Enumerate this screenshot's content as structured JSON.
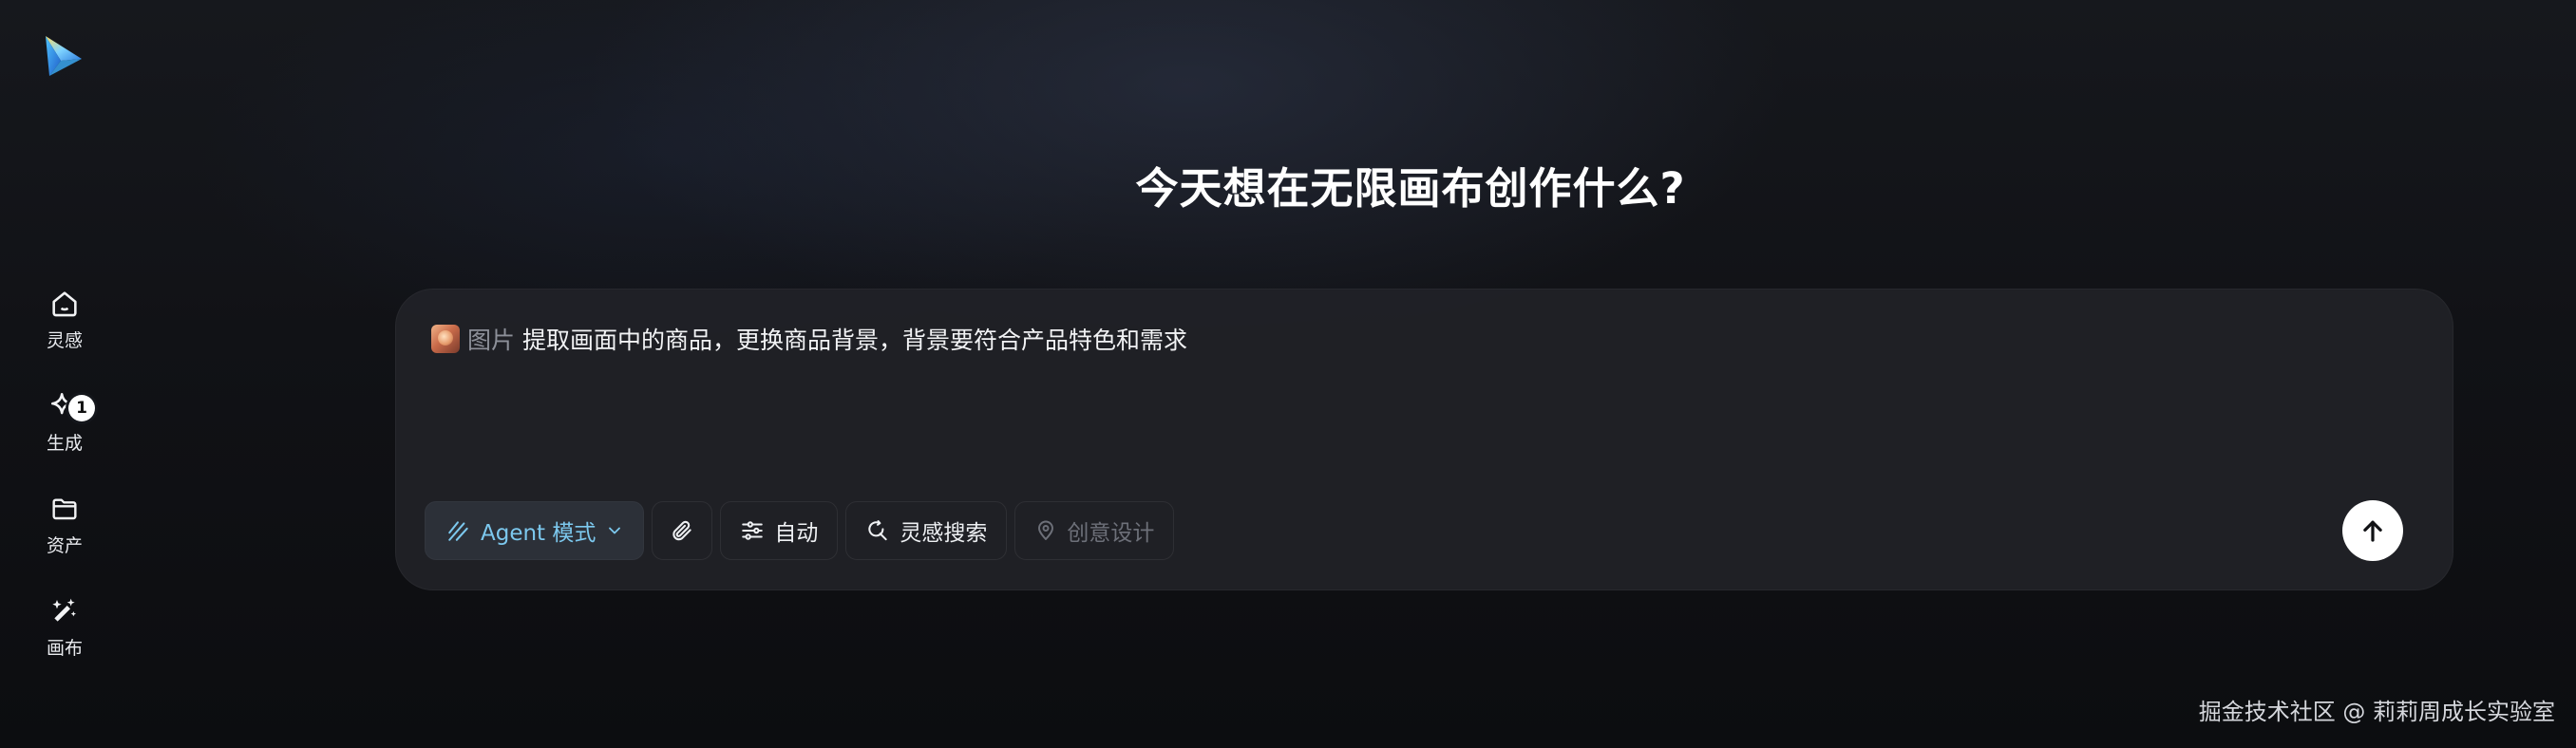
{
  "sidebar": {
    "logo": {
      "icon": "paper-plane-logo"
    },
    "items": [
      {
        "label": "灵感",
        "icon": "home-icon"
      },
      {
        "label": "生成",
        "icon": "sparkle-icon",
        "badge": "1"
      },
      {
        "label": "资产",
        "icon": "folder-icon"
      },
      {
        "label": "画布",
        "icon": "magic-wand-icon"
      }
    ]
  },
  "main": {
    "title": "今天想在无限画布创作什么?"
  },
  "composer": {
    "attachment_label": "图片",
    "prompt": "提取画面中的商品，更换商品背景，背景要符合产品特色和需求",
    "toolbar": {
      "agent_mode": "Agent 模式",
      "auto": "自动",
      "inspiration_search": "灵感搜索",
      "creative_design": "创意设计"
    }
  },
  "footer": {
    "watermark": "掘金技术社区 @ 莉莉周成长实验室"
  },
  "colors": {
    "background": "#0d0e11",
    "card": "#202127",
    "accent": "#7cc8ee",
    "send_button": "#ffffff"
  }
}
